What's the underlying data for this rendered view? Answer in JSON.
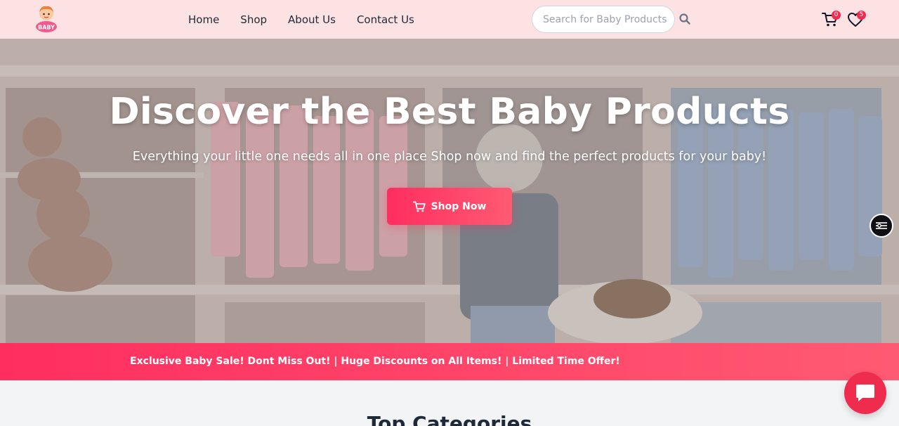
{
  "header": {
    "logo_text": "BABY",
    "nav": [
      "Home",
      "Shop",
      "About Us",
      "Contact Us"
    ],
    "search_placeholder": "Search for Baby Products",
    "cart_count": "0",
    "wishlist_count": "5"
  },
  "hero": {
    "title": "Discover the Best Baby Products",
    "subtitle": "Everything your little one needs all in one place Shop now and find the perfect products for your baby!",
    "cta_label": "Shop Now"
  },
  "promo": {
    "text": "Exclusive Baby Sale! Dont Miss Out!  |  Huge Discounts on All Items!  |  Limited Time Offer!"
  },
  "categories": {
    "title": "Top Categories"
  },
  "colors": {
    "header_bg": "#fde2e4",
    "accent": "#ff2e5f",
    "badge": "#ef2b4e"
  }
}
